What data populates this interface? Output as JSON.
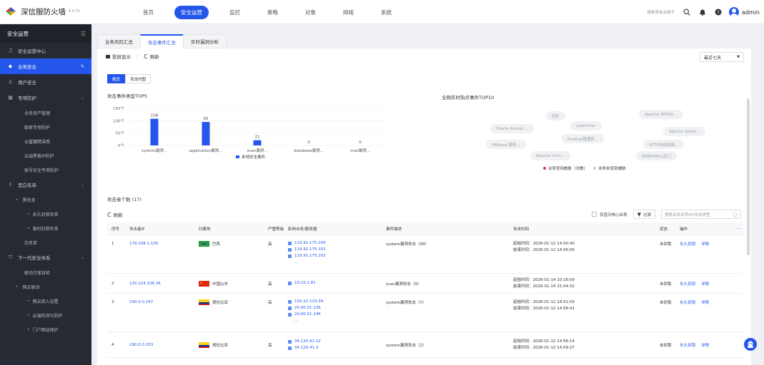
{
  "app": {
    "name": "深信服防火墙",
    "version": "8.0.75"
  },
  "topnav": {
    "items": [
      "首页",
      "安全运营",
      "监控",
      "策略",
      "对象",
      "网络",
      "系统"
    ],
    "active_index": 1
  },
  "header": {
    "search_placeholder": "搜索菜单关键字",
    "user": "admin"
  },
  "sidebar": {
    "title": "安全运营",
    "items": [
      {
        "label": "安全运营中心"
      },
      {
        "label": "业务安全"
      },
      {
        "label": "用户安全"
      },
      {
        "label": "专项防护"
      },
      {
        "label": "业务资产管理"
      },
      {
        "label": "勒索专项防护"
      },
      {
        "label": "云蜜罐精准感"
      },
      {
        "label": "云端黑客IP防护"
      },
      {
        "label": "账号安全专项防护"
      },
      {
        "label": "黑白名单"
      },
      {
        "label": "黑名单"
      },
      {
        "label": "永久封锁名单"
      },
      {
        "label": "临时封锁名单"
      },
      {
        "label": "白名单"
      },
      {
        "label": "下一代安全体系"
      },
      {
        "label": "联动方案自检"
      },
      {
        "label": "网云联动"
      },
      {
        "label": "网云接入设置"
      },
      {
        "label": "云端检测与防护"
      },
      {
        "label": "门户网站保护"
      }
    ]
  },
  "tabs": [
    "业务风险汇总",
    "攻击事件汇总",
    "实时漏洞分析"
  ],
  "toolbar": {
    "screen_label": "投屏显示",
    "refresh_label": "刷新",
    "range_value": "最近七天"
  },
  "view_buttons": [
    "概览",
    "攻击时图"
  ],
  "chart_data": {
    "type": "bar",
    "title": "攻击事件类型TOP5",
    "categories": [
      "system漏洞...",
      "application漏洞...",
      "scan漏洞...",
      "database漏洞...",
      "mail漏洞..."
    ],
    "series": [
      {
        "name": "本地安全事件",
        "values": [
          108,
          95,
          21,
          0,
          0
        ]
      }
    ],
    "yticks": [
      "150个",
      "100个",
      "50个",
      "0个"
    ],
    "ylim": [
      0,
      150
    ],
    "legend": "bottom"
  },
  "cloud": {
    "title": "全网实时热点事件TOP10",
    "words": [
      "挖矿",
      "Apache APISIX...",
      "Leafminer",
      "Oracle Access ...",
      "Fortinet管理员...",
      "Apache Spark...",
      "VMware 服务...",
      "HTTP协议缺陷...",
      "Apache Com...",
      "WEBSHELL后门"
    ],
    "legend": [
      "业务受到威胁（次数）",
      "业务未受到威胁"
    ],
    "legend_colors": [
      "#e53935",
      "#c8cbd0"
    ]
  },
  "attackers": {
    "title": "攻击者个数 (17)",
    "refresh_label": "刷新",
    "only_core": "仅显示核心业务",
    "filter_label": "过滤",
    "search_placeholder": "搜索业务名称/IP/攻击类型",
    "headers": [
      "序号",
      "攻击者IP",
      "归属地",
      "严重等级",
      "影响业务/服务器",
      "事件描述",
      "攻击时间",
      "状态",
      "操作"
    ],
    "rows": [
      {
        "no": "1",
        "ip": "179.108.1.105",
        "loc": "巴西",
        "level": "高",
        "servers": [
          "119.91.175.100",
          "119.91.175.101",
          "119.91.175.102"
        ],
        "more": "...",
        "desc": "system漏洞攻击（99）",
        "start": "起始时间：2026-01-12 14:50:40",
        "end": "结束时间：2026-01-12 14:56:56",
        "status": "未封锁",
        "op1": "永久封锁",
        "op2": "详情"
      },
      {
        "no": "2",
        "ip": "120.224.236.34",
        "loc": "中国山东",
        "level": "高",
        "servers": [
          "10.10.1.81"
        ],
        "more": "",
        "desc": "scan漏洞攻击（9）",
        "start": "起始时间：2026-01-14 10:16:09",
        "end": "结束时间：2026-01-14 15:04:32",
        "status": "未封锁",
        "op1": "永久封锁",
        "op2": "详情"
      },
      {
        "no": "3",
        "ip": "190.0.0.247",
        "loc": "哥伦比亚",
        "level": "高",
        "servers": [
          "150.22.123.34",
          "20.60.51.136",
          "20.60.51.146"
        ],
        "more": "...",
        "desc": "system漏洞攻击（7）",
        "start": "起始时间：2026-01-12 14:51:59",
        "end": "结束时间：2026-01-12 14:56:41",
        "status": "未封锁",
        "op1": "永久封锁",
        "op2": "详情"
      },
      {
        "no": "4",
        "ip": "190.0.0.253",
        "loc": "哥伦比亚",
        "level": "高",
        "servers": [
          "34.120.41.12",
          "34.120.41.3"
        ],
        "more": "",
        "desc": "system漏洞攻击（2）",
        "start": "起始时间：2026-01-12 14:56:14",
        "end": "结束时间：2026-01-12 14:59:27",
        "status": "未封锁",
        "op1": "永久封锁",
        "op2": "详情"
      }
    ]
  },
  "colors": {
    "accent": "#2456ec",
    "sidebar": "#262b33",
    "bar": "#2456ec"
  }
}
